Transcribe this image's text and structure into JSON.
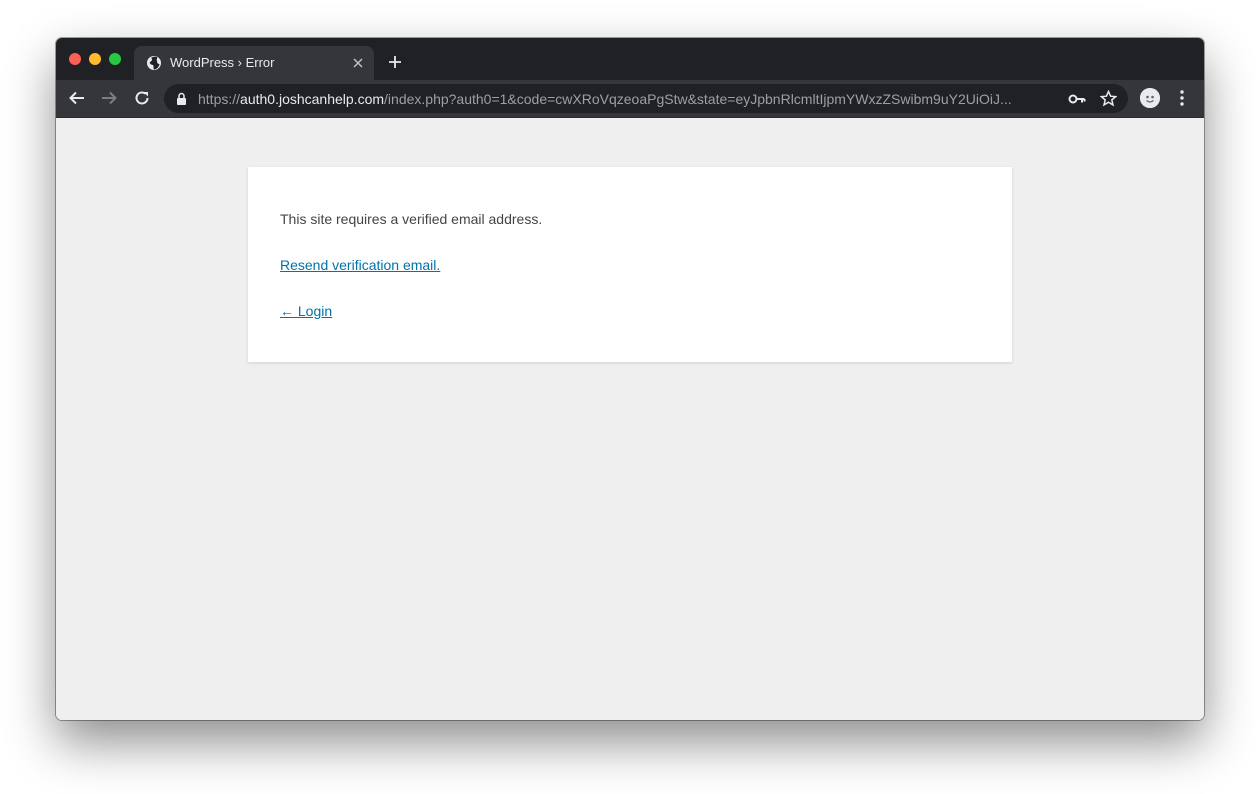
{
  "browser": {
    "tab": {
      "title": "WordPress › Error",
      "favicon": "globe-icon"
    },
    "address_bar": {
      "scheme": "https://",
      "host": "auth0.joshcanhelp.com",
      "path": "/index.php?auth0=1&code=cwXRoVqzeoaPgStw&state=eyJpbnRlcmltIjpmYWxzZSwibm9uY2UiOiJ..."
    },
    "icons": [
      "back-icon",
      "forward-icon",
      "reload-icon",
      "lock-icon",
      "key-icon",
      "star-icon",
      "avatar",
      "menu-icon",
      "close-icon",
      "new-tab-icon"
    ]
  },
  "page": {
    "message": "This site requires a verified email address.",
    "resend_link": "Resend verification email.",
    "login_link": "← Login"
  },
  "colors": {
    "link": "#0073aa",
    "page_background": "#efefef",
    "chrome_dark": "#202124",
    "chrome_toolbar": "#35363a"
  }
}
